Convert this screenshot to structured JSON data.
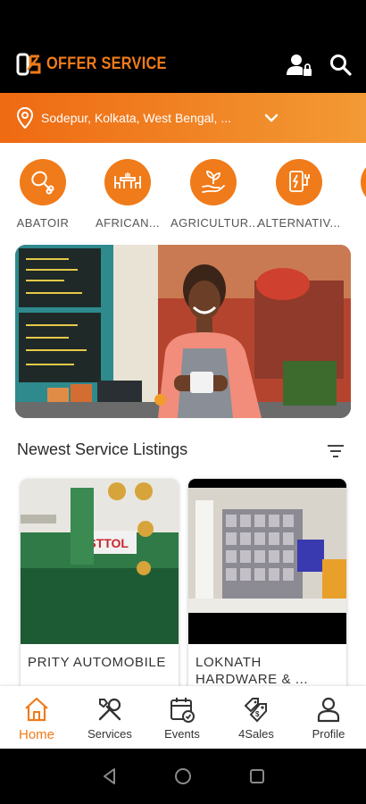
{
  "app": {
    "brand_name": "OFFER SERVICE",
    "accent_color": "#f07b1a"
  },
  "header": {
    "icons": [
      "user-lock-icon",
      "search-icon"
    ]
  },
  "location": {
    "text": "Sodepur, Kolkata, West Bengal, ...",
    "icon": "location-pin-icon"
  },
  "categories": [
    {
      "label": "ABATOIR",
      "icon": "chicken-leg-icon"
    },
    {
      "label": "AFRICAN...",
      "icon": "dining-table-icon"
    },
    {
      "label": "AGRICULTUR...",
      "icon": "plant-hand-icon"
    },
    {
      "label": "ALTERNATIV...",
      "icon": "battery-plug-icon"
    }
  ],
  "banner": {
    "image": "woman-at-cafe-counter-photo",
    "pager_active_index": 0
  },
  "newest": {
    "title": "Newest Service Listings",
    "filter_icon": "filter-icon"
  },
  "listings": [
    {
      "title": "PRITY AUTOMOBILE",
      "image": "auto-shop-photo"
    },
    {
      "title": "LOKNATH HARDWARE & ...",
      "image": "paint-shop-photo"
    }
  ],
  "bottom_nav": [
    {
      "label": "Home",
      "icon": "home-icon",
      "active": true
    },
    {
      "label": "Services",
      "icon": "tools-icon",
      "active": false
    },
    {
      "label": "Events",
      "icon": "calendar-icon",
      "active": false
    },
    {
      "label": "4Sales",
      "icon": "price-tags-icon",
      "active": false
    },
    {
      "label": "Profile",
      "icon": "person-icon",
      "active": false
    }
  ],
  "system_nav": [
    "back-icon",
    "home-circle-icon",
    "recents-icon"
  ]
}
